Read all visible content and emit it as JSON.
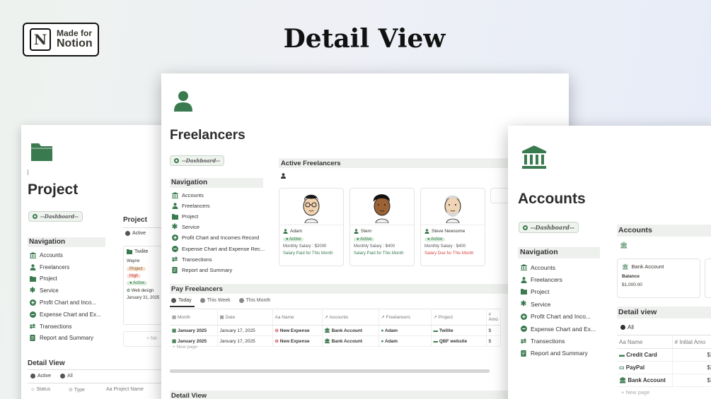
{
  "badge": {
    "line1": "Made for",
    "line2": "Notion",
    "logo": "N"
  },
  "title": "Detail View",
  "project_panel": {
    "title": "Project",
    "dashboard_btn": "--Dashboard--",
    "nav_header": "Navigation",
    "nav": [
      {
        "label": "Accounts",
        "icon": "bank-icon"
      },
      {
        "label": "Freelancers",
        "icon": "person-icon"
      },
      {
        "label": "Project",
        "icon": "folder-icon"
      },
      {
        "label": "Service",
        "icon": "asterisk-icon"
      },
      {
        "label": "Profit Chart and Inco...",
        "icon": "plus-circle-icon"
      },
      {
        "label": "Expense Chart and Ex...",
        "icon": "minus-circle-icon"
      },
      {
        "label": "Transections",
        "icon": "swap-icon"
      },
      {
        "label": "Report and Summary",
        "icon": "doc-icon"
      }
    ],
    "db_title": "Project",
    "tab_active": "Active",
    "card": {
      "name": "Twilite",
      "client": "Wayne",
      "tag1": "Project",
      "tag2": "High",
      "tag3": "Active",
      "service": "Web design",
      "date": "January 31, 2025"
    },
    "new_label": "+ Ne",
    "detail_title": "Detail View",
    "detail_tabs": [
      "Active",
      "All"
    ],
    "cols": [
      "Status",
      "Type",
      "Aa Project Name"
    ]
  },
  "freelancers_panel": {
    "title": "Freelancers",
    "dashboard_btn": "--Dashboard--",
    "nav_header": "Navigation",
    "nav": [
      {
        "label": "Accounts",
        "icon": "bank-icon"
      },
      {
        "label": "Freelancers",
        "icon": "person-icon"
      },
      {
        "label": "Project",
        "icon": "folder-icon"
      },
      {
        "label": "Service",
        "icon": "asterisk-icon"
      },
      {
        "label": "Profit Chart and Incomes Record",
        "icon": "plus-circle-icon"
      },
      {
        "label": "Expense Chart and Expense Rec...",
        "icon": "minus-circle-icon"
      },
      {
        "label": "Transections",
        "icon": "swap-icon"
      },
      {
        "label": "Report and Summary",
        "icon": "doc-icon"
      }
    ],
    "active_title": "Active Freelancers",
    "cards": [
      {
        "name": "Adam",
        "status": "Active",
        "salary": "Monthly Salary : $2000",
        "paid": "Salary Paid for This Month",
        "paid_color": "#3a7a4f",
        "skin": "#f2d3b0",
        "hair": "#1a1a1a",
        "glasses": true
      },
      {
        "name": "Stenr",
        "status": "Active",
        "salary": "Monthly Salary : $400",
        "paid": "Salary Paid for This Month",
        "paid_color": "#3a7a4f",
        "skin": "#9a6235",
        "hair": "#111",
        "glasses": false
      },
      {
        "name": "Steve Newsome",
        "status": "Active",
        "salary": "Monthly Salary : $400",
        "paid": "Salary Due for This Month",
        "paid_color": "#d64545",
        "skin": "#f0d4b6",
        "hair": "#d7d7d7",
        "glasses": false
      }
    ],
    "pay_title": "Pay Freelancers",
    "pay_tabs": [
      "Today",
      "This Week",
      "This Month"
    ],
    "table_cols": [
      "Month",
      "Date",
      "Aa Name",
      "Accounts",
      "Freelancers",
      "Project",
      "# Amo"
    ],
    "rows": [
      [
        "January 2025",
        "January 17, 2025",
        "New Expense",
        "Bank Account",
        "Adam",
        "Twilite",
        "$"
      ],
      [
        "January 2025",
        "January 17, 2025",
        "New Expense",
        "Bank Account",
        "Adam",
        "QBF website",
        "$"
      ]
    ],
    "new_page": "+ New page",
    "detail_title": "Detail View"
  },
  "accounts_panel": {
    "title": "Accounts",
    "dashboard_btn": "--Dashboard--",
    "nav_header": "Navigation",
    "nav": [
      {
        "label": "Accounts",
        "icon": "bank-icon"
      },
      {
        "label": "Freelancers",
        "icon": "person-icon"
      },
      {
        "label": "Project",
        "icon": "folder-icon"
      },
      {
        "label": "Service",
        "icon": "asterisk-icon"
      },
      {
        "label": "Profit Chart and Inco...",
        "icon": "plus-circle-icon"
      },
      {
        "label": "Expense Chart and Ex...",
        "icon": "minus-circle-icon"
      },
      {
        "label": "Transections",
        "icon": "swap-icon"
      },
      {
        "label": "Report and Summary",
        "icon": "doc-icon"
      }
    ],
    "db_title": "Accounts",
    "card": {
      "name": "Bank Account",
      "label": "Balance",
      "value": "$1,000.00"
    },
    "detail_title": "Detail view",
    "detail_tab": "All",
    "cols": [
      "Aa Name",
      "# Initial Amo"
    ],
    "rows": [
      {
        "name": "Credit Card",
        "amount": "$2,0"
      },
      {
        "name": "PayPal",
        "amount": "$2,0"
      },
      {
        "name": "Bank Account",
        "amount": "$2,0"
      }
    ],
    "new_page": "+ New page"
  }
}
